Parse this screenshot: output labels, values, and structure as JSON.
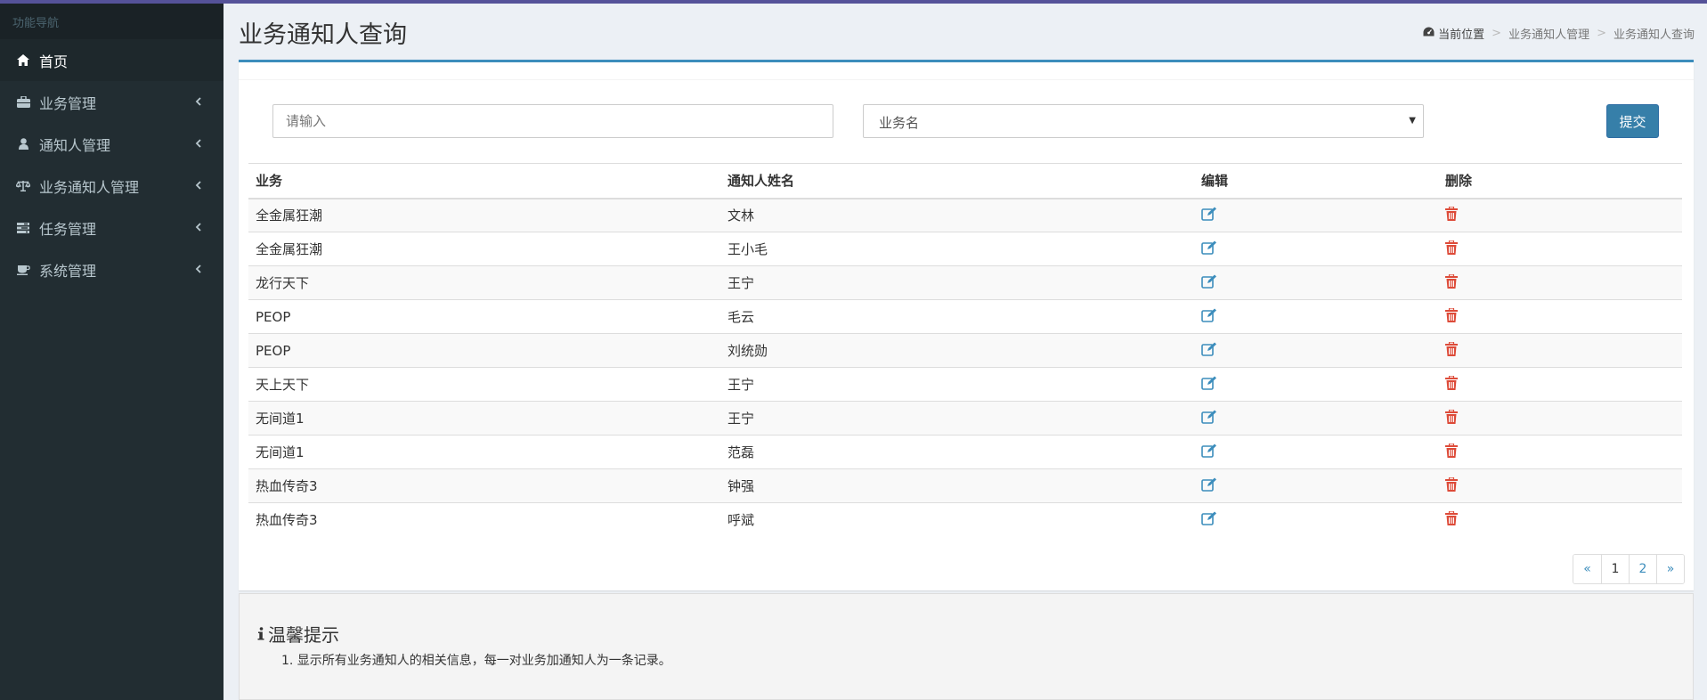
{
  "sidebar": {
    "header": "功能导航",
    "items": [
      {
        "label": "首页",
        "icon": "home-icon"
      },
      {
        "label": "业务管理",
        "icon": "briefcase-icon"
      },
      {
        "label": "通知人管理",
        "icon": "user-icon"
      },
      {
        "label": "业务通知人管理",
        "icon": "balance-scale-icon"
      },
      {
        "label": "任务管理",
        "icon": "tasks-icon"
      },
      {
        "label": "系统管理",
        "icon": "coffee-icon"
      }
    ]
  },
  "page": {
    "title": "业务通知人查询"
  },
  "breadcrumb": {
    "home": "当前位置",
    "items": [
      "业务通知人管理",
      "业务通知人查询"
    ]
  },
  "search": {
    "placeholder": "请输入",
    "select_value": "业务名",
    "submit_label": "提交"
  },
  "table": {
    "headers": [
      "业务",
      "通知人姓名",
      "编辑",
      "删除"
    ],
    "rows": [
      {
        "business": "全金属狂潮",
        "name": "文林"
      },
      {
        "business": "全金属狂潮",
        "name": "王小毛"
      },
      {
        "business": "龙行天下",
        "name": "王宁"
      },
      {
        "business": "PEOP",
        "name": "毛云"
      },
      {
        "business": "PEOP",
        "name": "刘统勋"
      },
      {
        "business": "天上天下",
        "name": "王宁"
      },
      {
        "business": "无间道1",
        "name": "王宁"
      },
      {
        "business": "无间道1",
        "name": "范磊"
      },
      {
        "business": "热血传奇3",
        "name": "钟强"
      },
      {
        "business": "热血传奇3",
        "name": "呼斌"
      }
    ]
  },
  "pagination": {
    "prev": "«",
    "pages": [
      "1",
      "2"
    ],
    "next": "»"
  },
  "tips": {
    "title": "温馨提示",
    "items": [
      "1. 显示所有业务通知人的相关信息，每一对业务加通知人为一条记录。"
    ]
  },
  "colors": {
    "sidebar_bg": "#222d32",
    "accent": "#3c8dbc",
    "edit_icon": "#3c8dbc",
    "delete_icon": "#dd4b39"
  }
}
